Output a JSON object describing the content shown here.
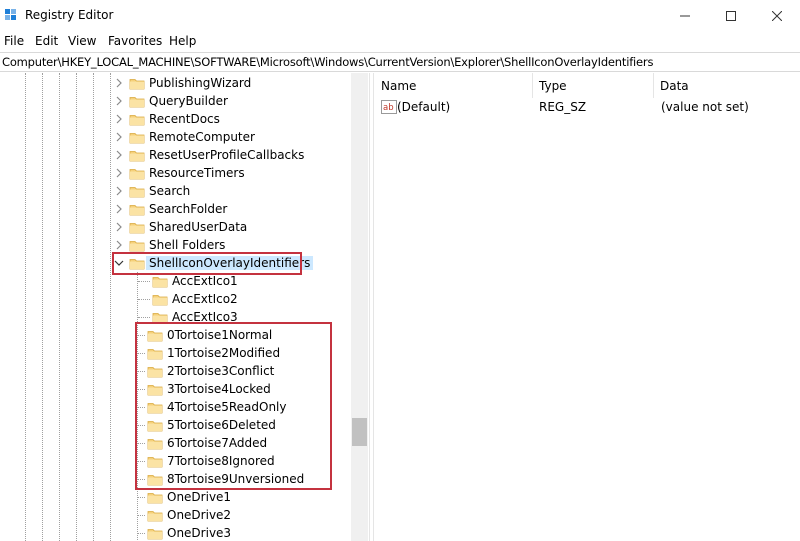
{
  "window": {
    "title": "Registry Editor",
    "controls": {
      "minimize": "minimize",
      "maximize": "maximize",
      "close": "close"
    }
  },
  "menu": [
    "File",
    "Edit",
    "View",
    "Favorites",
    "Help"
  ],
  "address": "Computer\\HKEY_LOCAL_MACHINE\\SOFTWARE\\Microsoft\\Windows\\CurrentVersion\\Explorer\\ShellIconOverlayIdentifiers",
  "tree": {
    "siblings": [
      "PublishingWizard",
      "QueryBuilder",
      "RecentDocs",
      "RemoteComputer",
      "ResetUserProfileCallbacks",
      "ResourceTimers",
      "Search",
      "SearchFolder",
      "SharedUserData",
      "Shell Folders"
    ],
    "selected": "ShellIconOverlayIdentifiers",
    "children": [
      "AccExtIco1",
      "AccExtIco2",
      "AccExtIco3",
      "0Tortoise1Normal",
      "1Tortoise2Modified",
      "2Tortoise3Conflict",
      "3Tortoise4Locked",
      "4Tortoise5ReadOnly",
      "5Tortoise6Deleted",
      "6Tortoise7Added",
      "7Tortoise8Ignored",
      "8Tortoise9Unversioned",
      "OneDrive1",
      "OneDrive2",
      "OneDrive3"
    ]
  },
  "list": {
    "columns": [
      "Name",
      "Type",
      "Data"
    ],
    "rows": [
      {
        "name": "(Default)",
        "type": "REG_SZ",
        "data": "(value not set)"
      }
    ]
  },
  "colors": {
    "highlight": "#c4323f",
    "selection": "#cce8ff",
    "folder": "#f5d07a"
  },
  "icons": {
    "folder": "folder-icon",
    "string_value": "string-value-icon"
  }
}
